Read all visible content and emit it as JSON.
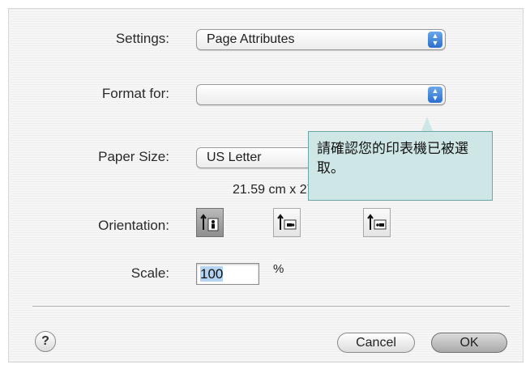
{
  "settings": {
    "label": "Settings:",
    "value": "Page Attributes"
  },
  "format_for": {
    "label": "Format for:",
    "value": ""
  },
  "paper_size": {
    "label": "Paper Size:",
    "value": "US Letter",
    "dimensions": "21.59 cm x 27.94 cm"
  },
  "orientation": {
    "label": "Orientation:",
    "options": [
      "portrait",
      "landscape-left",
      "landscape-right"
    ],
    "selected": "portrait"
  },
  "scale": {
    "label": "Scale:",
    "value": "100",
    "unit": "%"
  },
  "buttons": {
    "help": "?",
    "cancel": "Cancel",
    "ok": "OK"
  },
  "callout": {
    "text": "請確認您的印表機已被選取。"
  },
  "colors": {
    "accent": "#2a6fd0",
    "callout_bg": "#cfe6e6",
    "callout_border": "#6aa8a8"
  }
}
